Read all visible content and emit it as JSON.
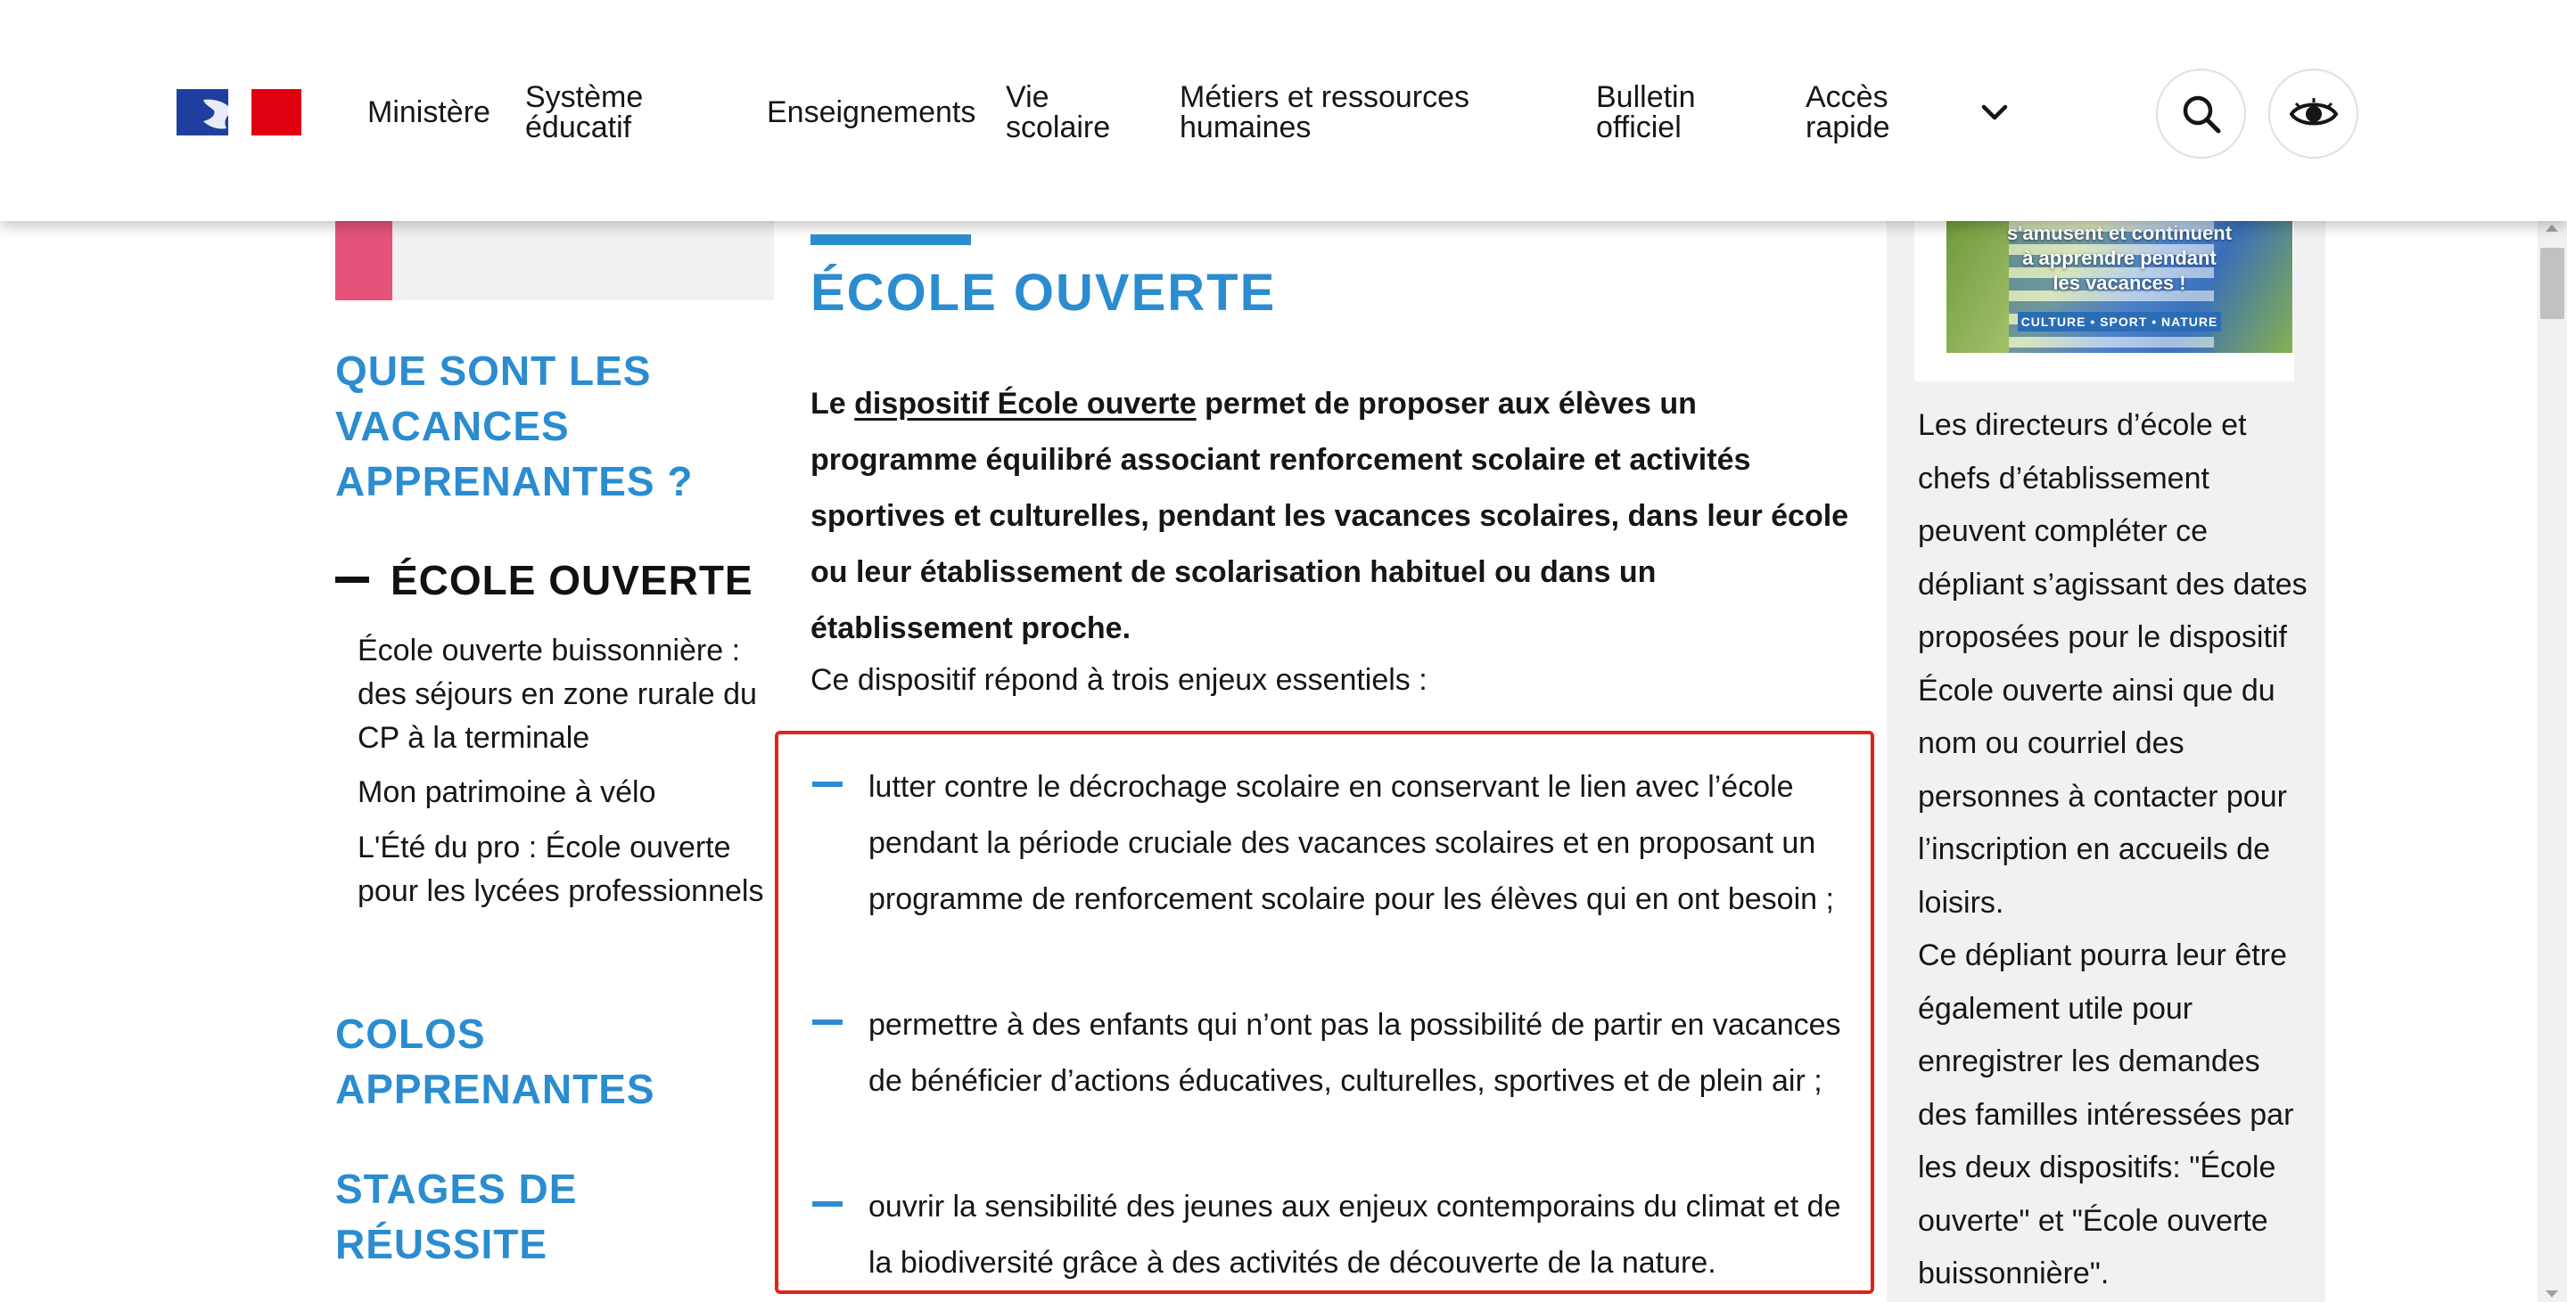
{
  "header": {
    "nav": [
      {
        "label": "Ministère"
      },
      {
        "label": "Système\néducatif"
      },
      {
        "label": "Enseignements"
      },
      {
        "label": "Vie\nscolaire"
      },
      {
        "label": "Métiers et ressources\nhumaines"
      },
      {
        "label": "Bulletin\nofficiel"
      },
      {
        "label": "Accès\nrapide"
      }
    ],
    "icons": {
      "logo": "republique-francaise-logo",
      "dropdown": "chevron-down-icon",
      "search": "search-icon",
      "accessibility": "eye-icon"
    }
  },
  "sidebar": {
    "categories": [
      {
        "label": "QUE SONT LES VACANCES APPRENANTES ?"
      },
      {
        "label": "COLOS APPRENANTES"
      },
      {
        "label": "STAGES DE RÉUSSITE"
      }
    ],
    "current": "ÉCOLE OUVERTE",
    "sub_items": [
      {
        "label": "École ouverte buissonnière : des séjours en zone rurale du CP à la terminale"
      },
      {
        "label": "Mon patrimoine à vélo"
      },
      {
        "label": "L'Été du pro : École ouverte pour les lycées professionnels"
      }
    ]
  },
  "main": {
    "title": "ÉCOLE OUVERTE",
    "lead_prefix": "Le ",
    "lead_link": "dispositif École ouverte",
    "lead_rest": " permet de proposer aux élèves un programme équilibré associant renforcement scolaire et activités sportives et culturelles, pendant les vacances scolaires, dans leur école ou leur établissement de scolarisation habituel ou dans un établissement proche.",
    "intro": "Ce dispositif répond à trois enjeux essentiels :",
    "bullets": [
      {
        "text": "lutter contre le décrochage scolaire en conservant le lien avec l’école pendant la période cruciale des vacances scolaires et en proposant un programme de renforcement scolaire pour les élèves qui en ont besoin ;"
      },
      {
        "text": "permettre à des enfants qui n’ont pas la possibilité de partir en vacances de bénéficier d’actions éducatives, culturelles, sportives et de plein air ;"
      },
      {
        "text": "ouvrir la sensibilité des jeunes aux enjeux contemporains du climat et de la biodiversité grâce à des activités de découverte de la nature."
      }
    ],
    "highlight_color": "#e2231a",
    "accent_color": "#2b8ccf"
  },
  "aside": {
    "image_caption": "s'amusent et continuent\nà apprendre pendant\nles vacances !",
    "image_tag": "CULTURE • SPORT • NATURE",
    "text": "Les directeurs d’école et chefs d’établissement peuvent compléter ce dépliant s’agissant des dates proposées pour le dispositif École ouverte ainsi que du nom ou courriel des personnes à contacter pour l’inscription en accueils de loisirs.\nCe dépliant pourra leur être également utile pour enregistrer les demandes des familles intéressées par les deux dispositifs: \"École ouverte\" et \"École ouverte buissonnière\"."
  }
}
